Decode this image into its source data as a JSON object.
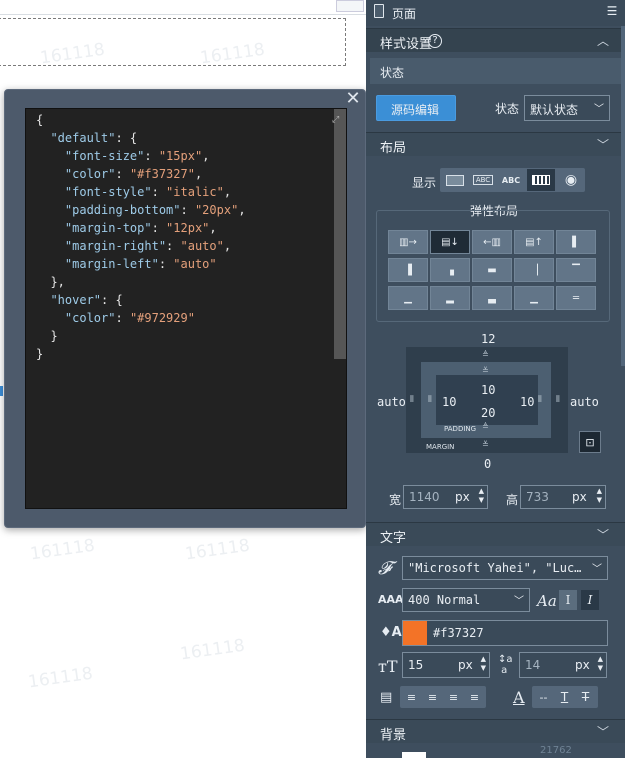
{
  "canvas": {
    "watermark": "161118"
  },
  "code_editor": {
    "close": "✕",
    "lines": [
      [
        {
          "t": "{",
          "c": ""
        }
      ],
      [
        {
          "t": "  \"default\"",
          "c": "k"
        },
        {
          "t": ": {",
          "c": ""
        }
      ],
      [
        {
          "t": "    \"font-size\"",
          "c": "k"
        },
        {
          "t": ": ",
          "c": ""
        },
        {
          "t": "\"15px\"",
          "c": "s"
        },
        {
          "t": ",",
          "c": ""
        }
      ],
      [
        {
          "t": "    \"color\"",
          "c": "k"
        },
        {
          "t": ": ",
          "c": ""
        },
        {
          "t": "\"#f37327\"",
          "c": "s"
        },
        {
          "t": ",",
          "c": ""
        }
      ],
      [
        {
          "t": "    \"font-style\"",
          "c": "k"
        },
        {
          "t": ": ",
          "c": ""
        },
        {
          "t": "\"italic\"",
          "c": "s"
        },
        {
          "t": ",",
          "c": ""
        }
      ],
      [
        {
          "t": "    \"padding-bottom\"",
          "c": "k"
        },
        {
          "t": ": ",
          "c": ""
        },
        {
          "t": "\"20px\"",
          "c": "s"
        },
        {
          "t": ",",
          "c": ""
        }
      ],
      [
        {
          "t": "    \"margin-top\"",
          "c": "k"
        },
        {
          "t": ": ",
          "c": ""
        },
        {
          "t": "\"12px\"",
          "c": "s"
        },
        {
          "t": ",",
          "c": ""
        }
      ],
      [
        {
          "t": "    \"margin-right\"",
          "c": "k"
        },
        {
          "t": ": ",
          "c": ""
        },
        {
          "t": "\"auto\"",
          "c": "s"
        },
        {
          "t": ",",
          "c": ""
        }
      ],
      [
        {
          "t": "    \"margin-left\"",
          "c": "k"
        },
        {
          "t": ": ",
          "c": ""
        },
        {
          "t": "\"auto\"",
          "c": "s"
        }
      ],
      [
        {
          "t": "  },",
          "c": ""
        }
      ],
      [
        {
          "t": "  \"hover\"",
          "c": "k"
        },
        {
          "t": ": {",
          "c": ""
        }
      ],
      [
        {
          "t": "    \"color\"",
          "c": "k"
        },
        {
          "t": ": ",
          "c": ""
        },
        {
          "t": "\"#972929\"",
          "c": "s"
        }
      ],
      [
        {
          "t": "  }",
          "c": ""
        }
      ],
      [
        {
          "t": "}",
          "c": ""
        }
      ]
    ]
  },
  "panel": {
    "page_title": "页面",
    "style_settings": "样式设置",
    "help": "?",
    "state_section": "状态",
    "source_edit_button": "源码编辑",
    "state_label": "状态",
    "state_value": "默认状态",
    "layout_section": "布局",
    "display_label": "显示",
    "display_options": [
      "block",
      "ABC",
      "ABC",
      "inline-block",
      "visible"
    ],
    "flex_title": "弹性布局",
    "box": {
      "margin_top": "12",
      "padding_top": "10",
      "padding_bottom": "20",
      "margin_bottom": "0",
      "margin_left": "auto",
      "margin_right": "auto",
      "padding_left": "10",
      "padding_right": "10",
      "padding_label": "PADDING",
      "margin_label": "MARGIN"
    },
    "width_label": "宽",
    "width_value": "1140",
    "width_unit": "px",
    "height_label": "高",
    "height_value": "733",
    "height_unit": "px",
    "text_section": "文字",
    "font_family": "\"Microsoft Yahei\", \"Luc…",
    "font_weight": "400 Normal",
    "color_value": "#f37327",
    "color_swatch": "#f37327",
    "font_size": "15",
    "font_size_unit": "px",
    "line_height": "14",
    "line_height_unit": "px",
    "background_section": "背景",
    "bottom_watermark": "21762"
  }
}
